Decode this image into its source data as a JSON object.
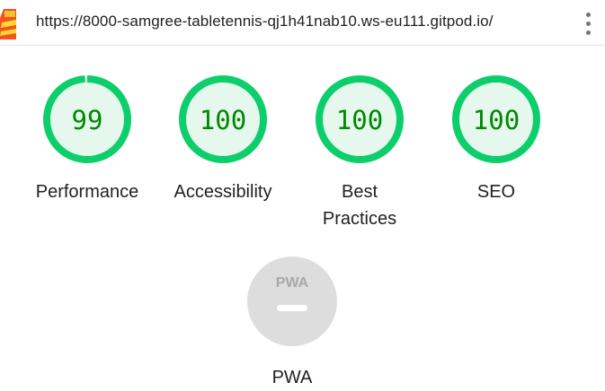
{
  "address_bar": {
    "url": "https://8000-samgree-tabletennis-qj1h41nab10.ws-eu111.gitpod.io/",
    "logo_icon": "lighthouse-icon",
    "menu_icon": "kebab-menu-icon"
  },
  "scores": [
    {
      "label": "Performance",
      "value": "99",
      "fraction": 0.99,
      "status": "pass"
    },
    {
      "label": "Accessibility",
      "value": "100",
      "fraction": 1.0,
      "status": "pass"
    },
    {
      "label": "Best\nPractices",
      "value": "100",
      "fraction": 1.0,
      "status": "pass"
    },
    {
      "label": "SEO",
      "value": "100",
      "fraction": 1.0,
      "status": "pass"
    }
  ],
  "pwa": {
    "label": "PWA",
    "badge_text": "PWA",
    "icon": "pwa-badge-icon"
  },
  "colors": {
    "pass_ring": "#0cce6b",
    "pass_fill": "#e6f8ee",
    "pass_text": "#008800",
    "pwa_fill": "#dddddd",
    "pwa_text": "#a8a8a8"
  }
}
